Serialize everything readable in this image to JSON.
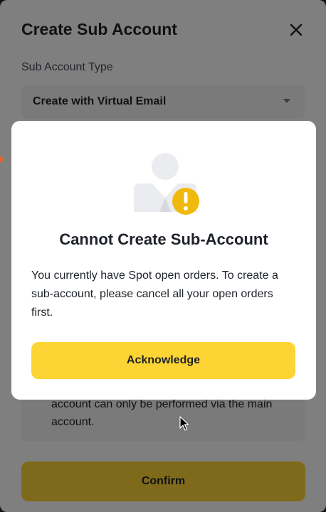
{
  "panel": {
    "title": "Create Sub Account",
    "close_icon": "close-icon",
    "field_label": "Sub Account Type",
    "select_value": "Create with Virtual Email",
    "select_icon": "caret-down-icon",
    "notice_lines": [
      "account can only be performed via the main",
      "account."
    ],
    "confirm_label": "Confirm"
  },
  "modal": {
    "illustration": "user-warning-icon",
    "title": "Cannot Create Sub-Account",
    "message": "You currently have Spot open orders. To create a sub-account, please cancel all your open orders first.",
    "button_label": "Acknowledge"
  },
  "colors": {
    "accent": "#fcd535",
    "warning": "#f0b90b",
    "text": "#1e2329"
  }
}
